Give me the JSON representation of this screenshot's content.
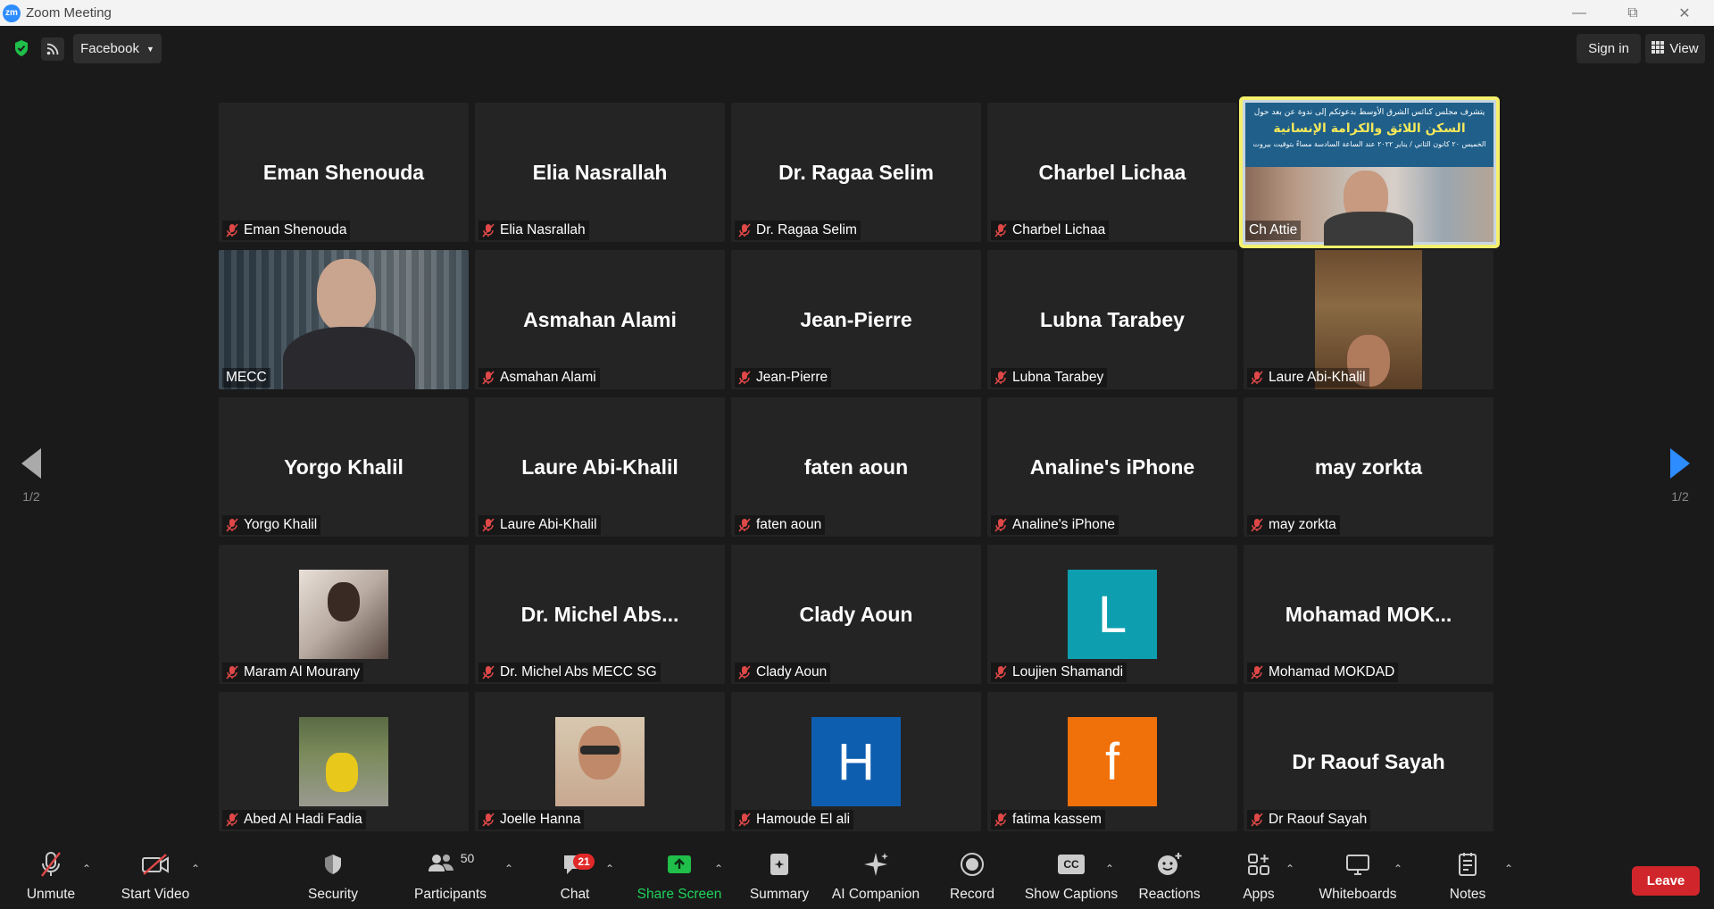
{
  "window": {
    "app_icon": "zm",
    "title": "Zoom Meeting"
  },
  "topbar": {
    "stream_label": "Facebook",
    "signin_label": "Sign in",
    "view_label": "View"
  },
  "pagination": {
    "left": "1/2",
    "right": "1/2"
  },
  "tiles": [
    {
      "display": "Eman Shenouda",
      "label": "Eman Shenouda"
    },
    {
      "display": "Elia Nasrallah",
      "label": "Elia Nasrallah"
    },
    {
      "display": "Dr. Ragaa Selim",
      "label": "Dr. Ragaa Selim"
    },
    {
      "display": "Charbel Lichaa",
      "label": "Charbel Lichaa"
    },
    {
      "display": "",
      "label": "Ch Attie"
    },
    {
      "display": "",
      "label": "MECC"
    },
    {
      "display": "Asmahan Alami",
      "label": "Asmahan Alami"
    },
    {
      "display": "Jean-Pierre",
      "label": "Jean-Pierre"
    },
    {
      "display": "Lubna Tarabey",
      "label": "Lubna Tarabey"
    },
    {
      "display": "",
      "label": "Laure Abi-Khalil"
    },
    {
      "display": "Yorgo Khalil",
      "label": "Yorgo Khalil"
    },
    {
      "display": "Laure Abi-Khalil",
      "label": "Laure Abi-Khalil"
    },
    {
      "display": "faten aoun",
      "label": "faten aoun"
    },
    {
      "display": "Analine's iPhone",
      "label": "Analine's iPhone"
    },
    {
      "display": "may zorkta",
      "label": "may zorkta"
    },
    {
      "display": "",
      "label": "Maram Al Mourany"
    },
    {
      "display": "Dr.  Michel  Abs...",
      "label": "Dr. Michel Abs MECC SG"
    },
    {
      "display": "Clady Aoun",
      "label": "Clady Aoun"
    },
    {
      "display": "L",
      "label": "Loujien Shamandi"
    },
    {
      "display": "Mohamad  MOK...",
      "label": "Mohamad MOKDAD"
    },
    {
      "display": "",
      "label": "Abed Al Hadi Fadia"
    },
    {
      "display": "",
      "label": "Joelle Hanna"
    },
    {
      "display": "H",
      "label": "Hamoude El ali"
    },
    {
      "display": "f",
      "label": "fatima kassem"
    },
    {
      "display": "Dr Raouf Sayah",
      "label": "Dr Raouf Sayah"
    }
  ],
  "banner": {
    "line1": "يتشرف مجلس كنائس الشرق الأوسط بدعوتكم إلى ندوة عن بعد حول",
    "line2": "السكن اللائق والكرامة الإنسانية",
    "line3": "الخميس ٢٠ كانون الثاني / يناير ٢٠٢٢ عند الساعة السادسة مساءً بتوقيت بيروت"
  },
  "colors": {
    "teal": "#0d9fb0",
    "blue": "#0e5eb0",
    "orange": "#f0700a",
    "active_border": "#f4f06d",
    "leave": "#d0262b"
  },
  "toolbar": {
    "unmute": "Unmute",
    "start_video": "Start Video",
    "security": "Security",
    "participants": "Participants",
    "participants_count": "50",
    "chat": "Chat",
    "chat_badge": "21",
    "share_screen": "Share Screen",
    "summary": "Summary",
    "ai_companion": "AI Companion",
    "record": "Record",
    "show_captions": "Show Captions",
    "captions_icon": "CC",
    "reactions": "Reactions",
    "apps": "Apps",
    "whiteboards": "Whiteboards",
    "notes": "Notes",
    "leave": "Leave"
  }
}
